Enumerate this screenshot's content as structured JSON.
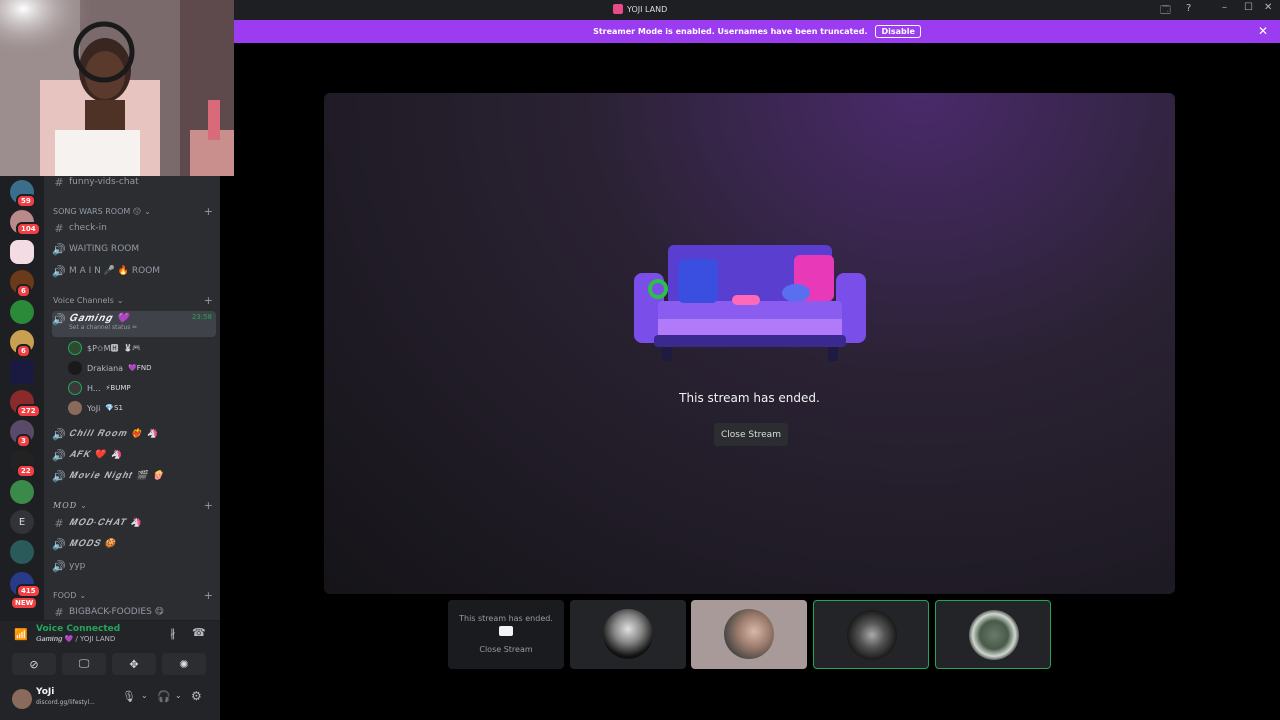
{
  "window": {
    "title": "YOJI LAND"
  },
  "banner": {
    "text": "Streamer Mode is enabled. Usernames have been truncated.",
    "disable_label": "Disable"
  },
  "rail": {
    "badges": [
      {
        "count": "59"
      },
      {
        "count": "104"
      },
      {
        "count": "6"
      },
      {
        "count": "6"
      },
      {
        "count": "272"
      },
      {
        "count": "3"
      },
      {
        "count": "22"
      },
      {
        "count": "415"
      }
    ],
    "letter": "E",
    "new_label": "NEW"
  },
  "sidebar": {
    "top_channel": "funny-vids-chat",
    "song_wars": {
      "label": "SONG WARS ROOM 😗"
    },
    "check_in": "check-in",
    "waiting_room": "WAITING ROOM",
    "main_room": "M A I N 🎤 🔥 ROOM",
    "voice_category": "Voice Channels",
    "gaming": {
      "name": "𝑮𝒂𝒎𝒊𝒏𝒈 💜",
      "timer": "23:58",
      "status": "Set a channel status ✏"
    },
    "users": [
      {
        "name": "$P✩M🅷",
        "tag": "🐰🎮"
      },
      {
        "name": "Drakiana",
        "tag": "💜FND"
      },
      {
        "name": "H...",
        "tag": "⚡BUMP"
      },
      {
        "name": "YoJi",
        "tag": "💎S1"
      }
    ],
    "chill_room": "𝑪𝒉𝒊𝒍𝒍 𝑹𝒐𝒐𝒎 ❤️‍🔥 🦄",
    "afk": "𝑨𝑭𝑲 ❤️ 🦄",
    "movie_night": "𝑴𝒐𝒗𝒊𝒆 𝑵𝒊𝒈𝒉𝒕 🎬 🍿",
    "mod_category": "MOD",
    "mod_chat": "𝑴𝑶𝑫-𝑪𝑯𝑨𝑻 🦄",
    "mods": "𝑴𝑶𝑫𝑺 🍪",
    "yyp": "yyp",
    "food_category": "FOOD",
    "bigback": "BIGBACK-FOODIES 😋"
  },
  "voice": {
    "status": "Voice Connected",
    "channel": "𝑮𝒂𝒎𝒊𝒏𝒈 💜 / YOJI LAND"
  },
  "user_panel": {
    "name": "YoJi",
    "status": "discord.gg/lifestyl..."
  },
  "stage": {
    "ended_text": "This stream has ended.",
    "close_label": "Close Stream"
  },
  "tiles": [
    {
      "ended_text": "This stream has ended.",
      "close_label": "Close Stream"
    }
  ],
  "colors": {
    "accent": "#9b3cf0",
    "speaking": "#23a55a",
    "badge": "#f23f43"
  }
}
